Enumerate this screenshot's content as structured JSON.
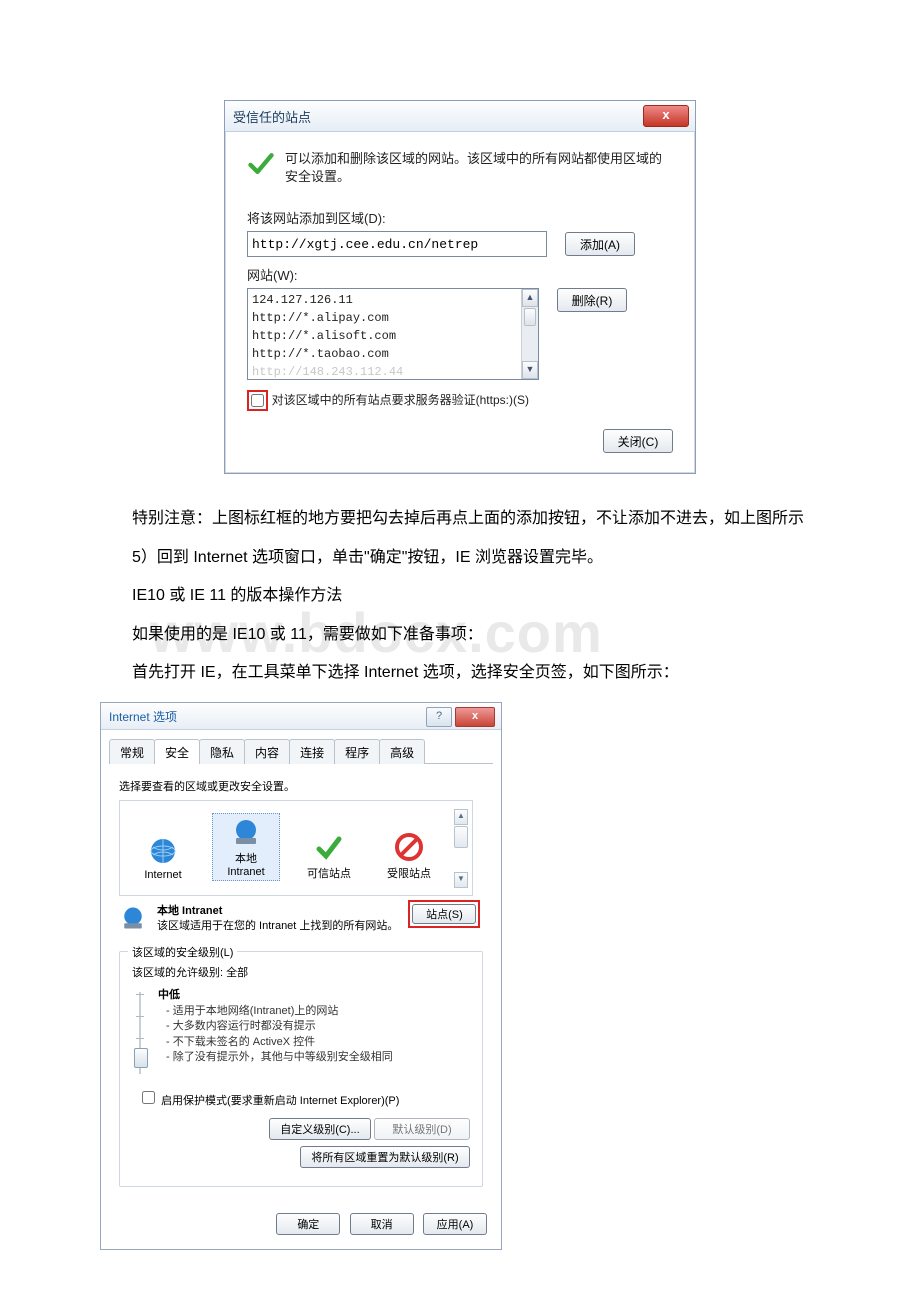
{
  "trusted": {
    "title": "受信任的站点",
    "intro": "可以添加和删除该区域的网站。该区域中的所有网站都使用区域的安全设置。",
    "addLabel": "将该网站添加到区域(D):",
    "addValue": "http://xgtj.cee.edu.cn/netrep",
    "addBtn": "添加(A)",
    "sitesLabel": "网站(W):",
    "sites": [
      "124.127.126.11",
      "http://*.alipay.com",
      "http://*.alisoft.com",
      "http://*.taobao.com",
      "http://148.243.112.44"
    ],
    "removeBtn": "删除(R)",
    "httpsLabel": "对该区域中的所有站点要求服务器验证(https:)(S)",
    "closeBtn": "关闭(C)"
  },
  "body": {
    "p1": "特别注意：上图标红框的地方要把勾去掉后再点上面的添加按钮，不让添加不进去，如上图所示",
    "p2": "5）回到 Internet 选项窗口，单击\"确定\"按钮，IE 浏览器设置完毕。",
    "p3": "IE10 或 IE 11 的版本操作方法",
    "p4": "如果使用的是 IE10 或 11，需要做如下准备事项：",
    "p5": "首先打开 IE，在工具菜单下选择 Internet 选项，选择安全页签，如下图所示："
  },
  "watermark": "www.bdocx.com",
  "opts": {
    "title": "Internet 选项",
    "tabs": [
      "常规",
      "安全",
      "隐私",
      "内容",
      "连接",
      "程序",
      "高级"
    ],
    "activeTab": 1,
    "zoneHint": "选择要查看的区域或更改安全设置。",
    "zones": [
      "Internet",
      "本地 Intranet",
      "可信站点",
      "受限站点"
    ],
    "selectedZone": 1,
    "zoneTitle": "本地 Intranet",
    "zoneDesc": "该区域适用于在您的 Intranet 上找到的所有网站。",
    "sitesBtn": "站点(S)",
    "secLegend": "该区域的安全级别(L)",
    "allowLabel": "该区域的允许级别: 全部",
    "level": "中低",
    "bullets": [
      "适用于本地网络(Intranet)上的网站",
      "大多数内容运行时都没有提示",
      "不下载未签名的 ActiveX 控件",
      "除了没有提示外，其他与中等级别安全级相同"
    ],
    "protectMode": "启用保护模式(要求重新启动 Internet Explorer)(P)",
    "customBtn": "自定义级别(C)...",
    "defaultBtn": "默认级别(D)",
    "resetBtn": "将所有区域重置为默认级别(R)",
    "ok": "确定",
    "cancel": "取消",
    "apply": "应用(A)"
  }
}
